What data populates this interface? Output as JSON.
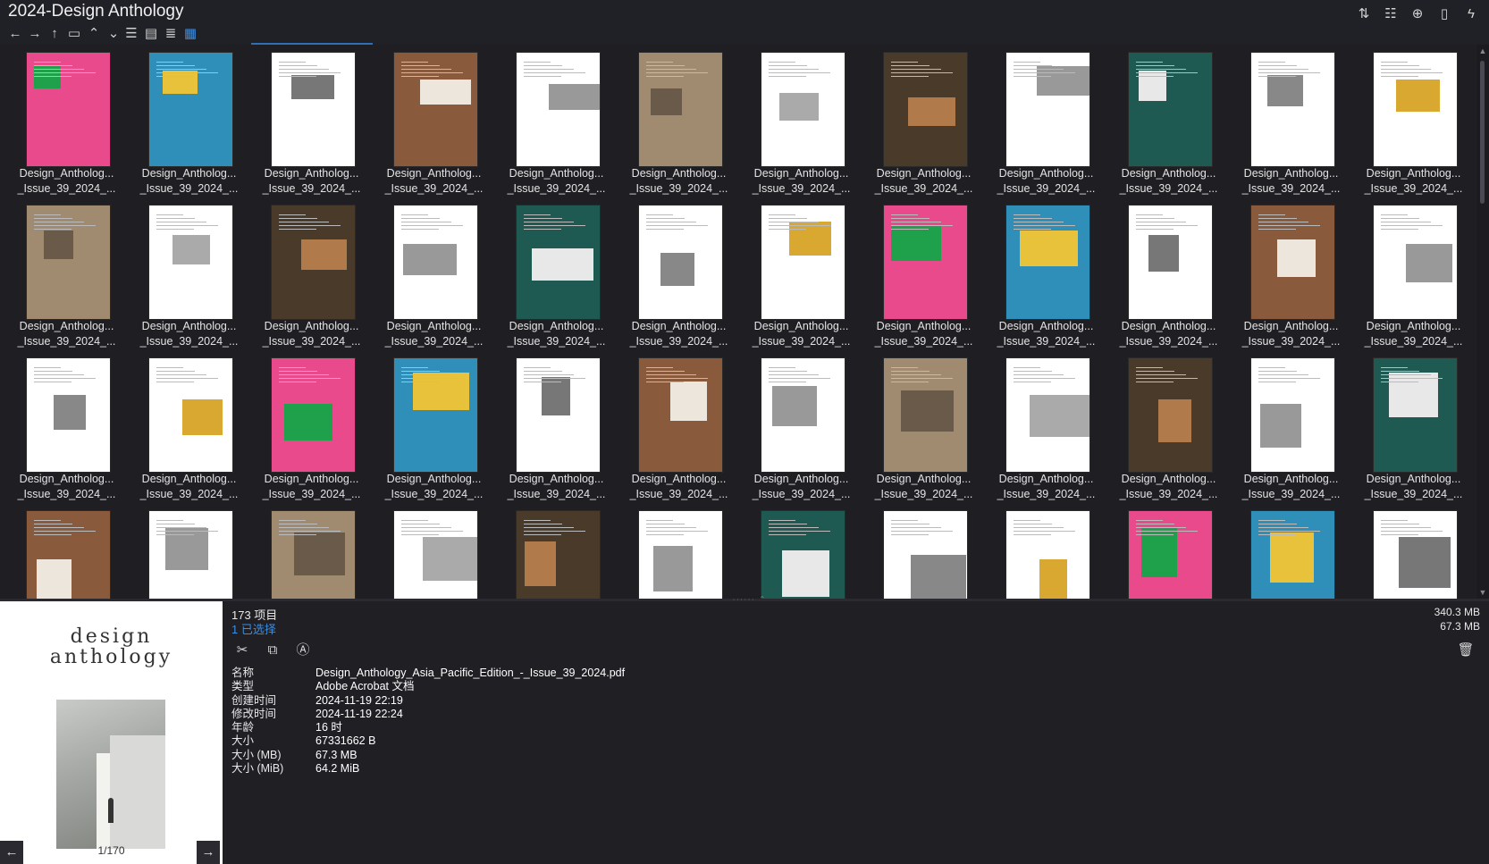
{
  "window": {
    "title": "2024-Design Anthology"
  },
  "toolbar": {
    "nav_icons": [
      "back-icon",
      "forward-icon",
      "up-icon",
      "folder-icon",
      "chevron-up-icon",
      "chevron-down-icon"
    ],
    "view_icons": [
      "details-view-icon",
      "tiles-view-icon",
      "list-view-icon",
      "thumbnails-view-icon"
    ],
    "right_icons": [
      "sort-icon",
      "list-settings-icon",
      "add-icon",
      "clipboard-icon",
      "lightning-icon"
    ]
  },
  "files": {
    "caption_line1": "Design_Antholog...",
    "caption_line2": "_Issue_39_2024_...",
    "rows_visible": 4,
    "columns": 12
  },
  "status": {
    "item_count": "173 项目",
    "selected": "1 已选择",
    "total_size": "340.3 MB",
    "selected_size": "67.3 MB"
  },
  "preview": {
    "logo_line1": "design",
    "logo_line2": "anthology",
    "page_indicator": "1/170",
    "prev_label": "←",
    "next_label": "→"
  },
  "properties": [
    {
      "key": "名称",
      "value": "Design_Anthology_Asia_Pacific_Edition_-_Issue_39_2024.pdf"
    },
    {
      "key": "类型",
      "value": "Adobe Acrobat 文档"
    },
    {
      "key": "创建时间",
      "value": "2024-11-19  22:19"
    },
    {
      "key": "修改时间",
      "value": "2024-11-19  22:24"
    },
    {
      "key": "年龄",
      "value": "16 时"
    },
    {
      "key": "大小",
      "value": "67331662 B"
    },
    {
      "key": "大小 (MB)",
      "value": "67.3 MB"
    },
    {
      "key": "大小 (MiB)",
      "value": "64.2 MiB"
    }
  ],
  "colors": {
    "accent": "#3a8ee6",
    "background": "#1f1f24"
  }
}
